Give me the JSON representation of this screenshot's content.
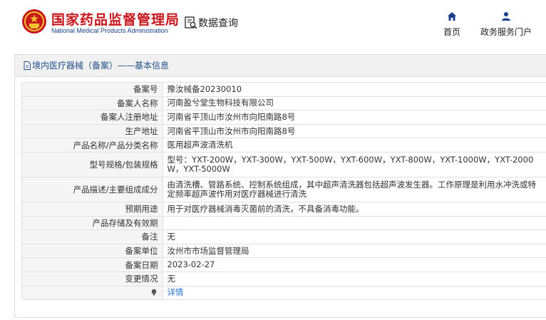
{
  "header": {
    "site_title": "国家药品监督管理局",
    "site_subtitle": "National Medical Products Administration",
    "query_label": "数据查询",
    "nav": {
      "home": "首页",
      "portal": "政务服务门户"
    }
  },
  "panel": {
    "title": "境内医疗器械（备案）——基本信息"
  },
  "rows": {
    "r0": {
      "label": "备案号",
      "value": "豫汝械备20230010"
    },
    "r1": {
      "label": "备案人名称",
      "value": "河南盈兮堂生物科技有限公司"
    },
    "r2": {
      "label": "备案人注册地址",
      "value": "河南省平顶山市汝州市向阳南路8号"
    },
    "r3": {
      "label": "生产地址",
      "value": "河南省平顶山市汝州市向阳南路8号"
    },
    "r4": {
      "label": "产品名称/产品分类名称",
      "value": "医用超声波清洗机"
    },
    "r5": {
      "label": "型号规格/包装规格",
      "value": "型号：YXT-200W，YXT-300W，YXT-500W，YXT-600W，YXT-800W，YXT-1000W，YXT-2000W，YXT-5000W"
    },
    "r6": {
      "label": "产品描述/主要组成成分",
      "value": "由清洗槽、管路系统、控制系统组成，其中超声清洗器包括超声波发生器。工作原理是利用水冲洗或特定频率超声波作用对医疗器械进行清洗"
    },
    "r7": {
      "label": "预期用途",
      "value": "用于对医疗器械消毒灭菌前的清洗，不具备消毒功能。"
    },
    "r8": {
      "label": "产品存储及有效期",
      "value": ""
    },
    "r9": {
      "label": "备注",
      "value": "无"
    },
    "r10": {
      "label": "备案单位",
      "value": "汝州市市场监督管理局"
    },
    "r11": {
      "label": "备案日期",
      "value": "2023-02-27"
    },
    "r12": {
      "label": "变更情况",
      "value": "无"
    },
    "r13": {
      "label": "",
      "value": "详情"
    }
  },
  "colors": {
    "brand_red": "#c8161d",
    "brand_blue": "#1a3f8a",
    "link_blue": "#1e6fcc",
    "label_bg": "#f5f5f5",
    "header_bar_bg": "#f1f1f1"
  },
  "icons": {
    "logo": "national-emblem-icon",
    "query": "search-document-icon",
    "home": "home-icon",
    "portal": "user-icon",
    "panel_title": "document-icon",
    "detail_row": "pin-icon"
  }
}
